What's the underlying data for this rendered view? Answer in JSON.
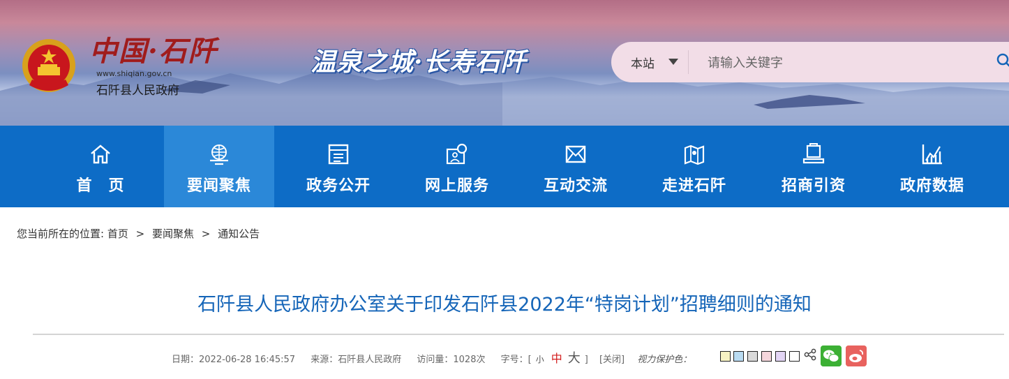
{
  "header": {
    "site_title": "中国·石阡",
    "site_url": "www.shiqian.gov.cn",
    "site_name": "石阡县人民政府",
    "slogan": "温泉之城·长寿石阡"
  },
  "search": {
    "scope": "本站",
    "placeholder": "请输入关键字"
  },
  "nav": {
    "items": [
      {
        "label": "首　页",
        "icon": "home-icon"
      },
      {
        "label": "要闻聚焦",
        "icon": "globe-monitor-icon",
        "active": true
      },
      {
        "label": "政务公开",
        "icon": "document-icon"
      },
      {
        "label": "网上服务",
        "icon": "user-service-icon"
      },
      {
        "label": "互动交流",
        "icon": "mail-icon"
      },
      {
        "label": "走进石阡",
        "icon": "map-icon"
      },
      {
        "label": "招商引资",
        "icon": "handshake-icon"
      },
      {
        "label": "政府数据",
        "icon": "chart-icon"
      }
    ],
    "colors": {
      "bar": "#0d6cc6",
      "active": "#2b88d8"
    }
  },
  "breadcrumb": {
    "prefix": "您当前所在的位置:",
    "items": [
      "首页",
      "要闻聚焦",
      "通知公告"
    ],
    "separator": ">"
  },
  "article": {
    "title": "石阡县人民政府办公室关于印发石阡县2022年“特岗计划”招聘细则的通知",
    "date": "日期：2022-06-28 16:45:57",
    "source": "来源：石阡县人民政府",
    "views": "访问量：1028次",
    "font_size_label": "字号：[",
    "font_small": "小",
    "font_medium": "中",
    "font_large": "大",
    "font_close_bracket": "]",
    "close": "[关闭]",
    "vision_label": "视力保护色：",
    "swatches": [
      "#f7f3c4",
      "#b9dbf2",
      "#d9d9d9",
      "#f5d6dc",
      "#e3d5f5",
      "#ffffff"
    ]
  }
}
